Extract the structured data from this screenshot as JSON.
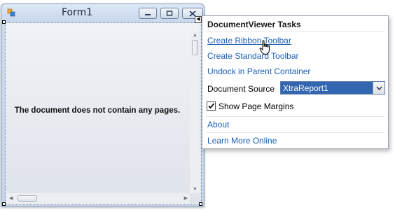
{
  "form": {
    "title": "Form1",
    "empty_message": "The document does not contain any pages."
  },
  "tasks": {
    "title": "DocumentViewer Tasks",
    "create_ribbon": "Create Ribbon Toolbar",
    "create_standard": "Create Standard Toolbar",
    "undock": "Undock in Parent Container",
    "document_source_label": "Document Source",
    "document_source_value": "XtraReport1",
    "show_margins_label": "Show Page Margins",
    "show_margins_checked": true,
    "about": "About",
    "learn_more": "Learn More Online"
  },
  "colors": {
    "link": "#1a5fb4",
    "selection": "#3366b0"
  }
}
